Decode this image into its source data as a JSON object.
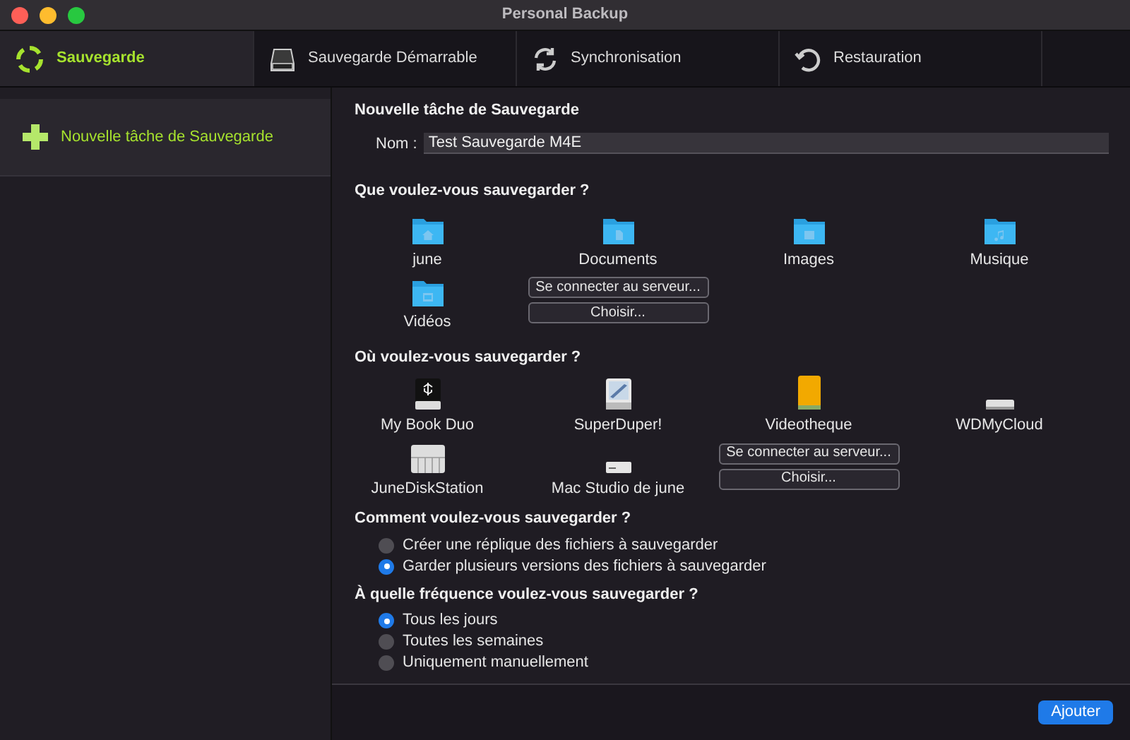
{
  "window": {
    "title": "Personal Backup"
  },
  "tabs": [
    {
      "label": "Sauvegarde",
      "kind": "backup",
      "selected": true
    },
    {
      "label": "Sauvegarde Démarrable",
      "kind": "disk",
      "selected": false
    },
    {
      "label": "Synchronisation",
      "kind": "sync",
      "selected": false
    },
    {
      "label": "Restauration",
      "kind": "restore",
      "selected": false
    }
  ],
  "sidebar": {
    "items": [
      {
        "label": "Nouvelle tâche de Sauvegarde",
        "selected": true
      }
    ]
  },
  "form": {
    "heading": "Nouvelle tâche de Sauvegarde",
    "name_label": "Nom :",
    "name_value": "Test Sauvegarde M4E"
  },
  "sources": {
    "heading": "Que voulez-vous sauvegarder ?",
    "items": [
      {
        "label": "june",
        "kind": "home"
      },
      {
        "label": "Documents",
        "kind": "documents"
      },
      {
        "label": "Images",
        "kind": "images"
      },
      {
        "label": "Musique",
        "kind": "music"
      },
      {
        "label": "Vidéos",
        "kind": "videos"
      }
    ],
    "buttons": [
      "Se connecter au serveur...",
      "Choisir..."
    ]
  },
  "destinations": {
    "heading": "Où voulez-vous sauvegarder ?",
    "items": [
      {
        "label": "My Book Duo",
        "kind": "usb"
      },
      {
        "label": "SuperDuper!",
        "kind": "image"
      },
      {
        "label": "Videotheque",
        "kind": "external"
      },
      {
        "label": "WDMyCloud",
        "kind": "server"
      },
      {
        "label": "JuneDiskStation",
        "kind": "nas"
      },
      {
        "label": "Mac Studio de june",
        "kind": "computer"
      }
    ],
    "buttons": [
      "Se connecter au serveur...",
      "Choisir..."
    ]
  },
  "method": {
    "heading": "Comment voulez-vous sauvegarder ?",
    "options": [
      {
        "label": "Créer une réplique des fichiers à sauvegarder",
        "selected": false
      },
      {
        "label": "Garder plusieurs versions des fichiers à sauvegarder",
        "selected": true
      }
    ]
  },
  "frequency": {
    "heading": "À quelle fréquence voulez-vous sauvegarder ?",
    "options": [
      {
        "label": "Tous les jours",
        "selected": true
      },
      {
        "label": "Toutes les semaines",
        "selected": false
      },
      {
        "label": "Uniquement manuellement",
        "selected": false
      }
    ]
  },
  "footer": {
    "button": "Ajouter"
  }
}
